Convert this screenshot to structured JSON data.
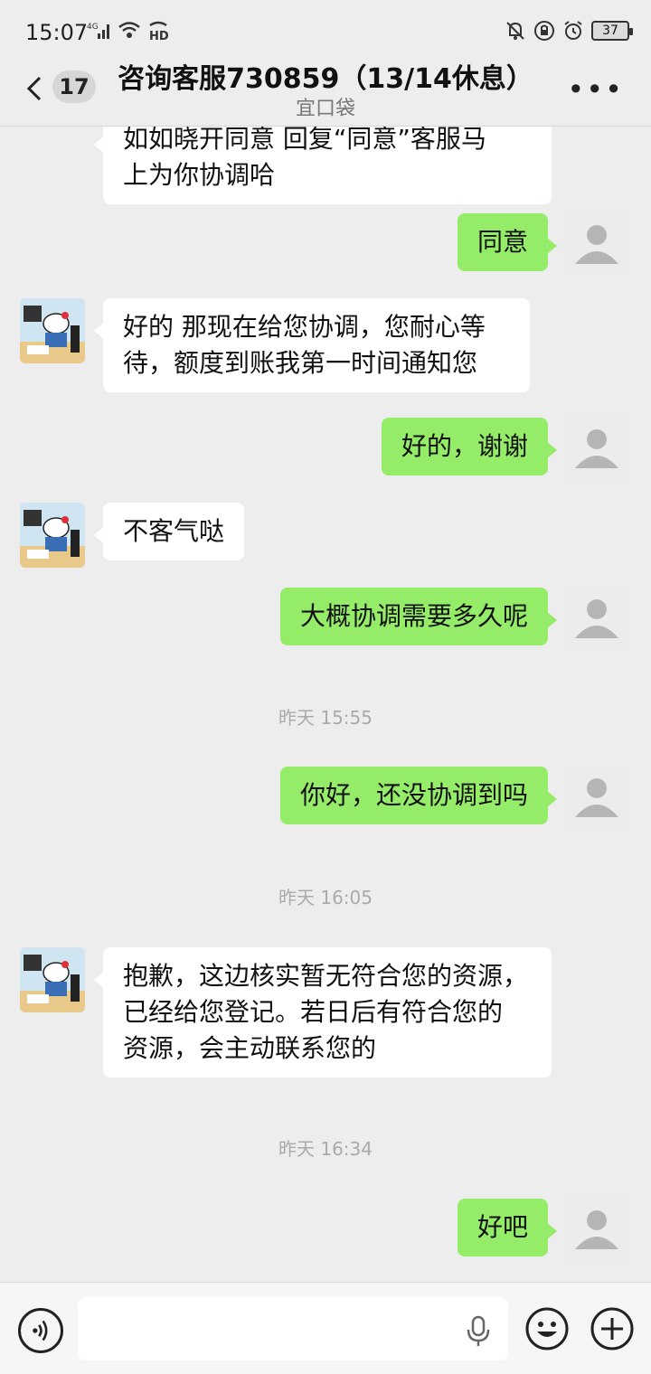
{
  "status_bar": {
    "time": "15:07",
    "network": "4G",
    "hd": "HD",
    "battery": "37"
  },
  "header": {
    "unread_count": "17",
    "title": "咨询客服730859（13/14休息）",
    "subtitle": "宜口袋"
  },
  "messages": {
    "m0": {
      "side": "left",
      "lines": [
        "如如晓开同意 回复“同意”客服马",
        "上为你协调哈"
      ]
    },
    "m1": {
      "side": "right",
      "text": "同意"
    },
    "m2": {
      "side": "left",
      "lines": [
        "好的 那现在给您协调，您耐心等",
        "待，额度到账我第一时间通知您"
      ]
    },
    "m3": {
      "side": "right",
      "text": "好的，谢谢"
    },
    "m4": {
      "side": "left",
      "text": "不客气哒"
    },
    "m5": {
      "side": "right",
      "text": "大概协调需要多久呢"
    },
    "t1": "昨天 15:55",
    "m6": {
      "side": "right",
      "text": "你好，还没协调到吗"
    },
    "t2": "昨天 16:05",
    "m7": {
      "side": "left",
      "lines": [
        "抱歉，这边核实暂无符合您的资源，",
        "已经给您登记。若日后有符合您的",
        "资源，会主动联系您的"
      ]
    },
    "t3": "昨天 16:34",
    "m8": {
      "side": "right",
      "text": "好吧"
    }
  },
  "input_bar": {
    "placeholder": "",
    "icons": [
      "voice-icon",
      "mic-icon",
      "emoji-icon",
      "plus-icon"
    ]
  },
  "colors": {
    "background": "#ededed",
    "bubble_right": "#95ec69",
    "bubble_left": "#ffffff"
  }
}
